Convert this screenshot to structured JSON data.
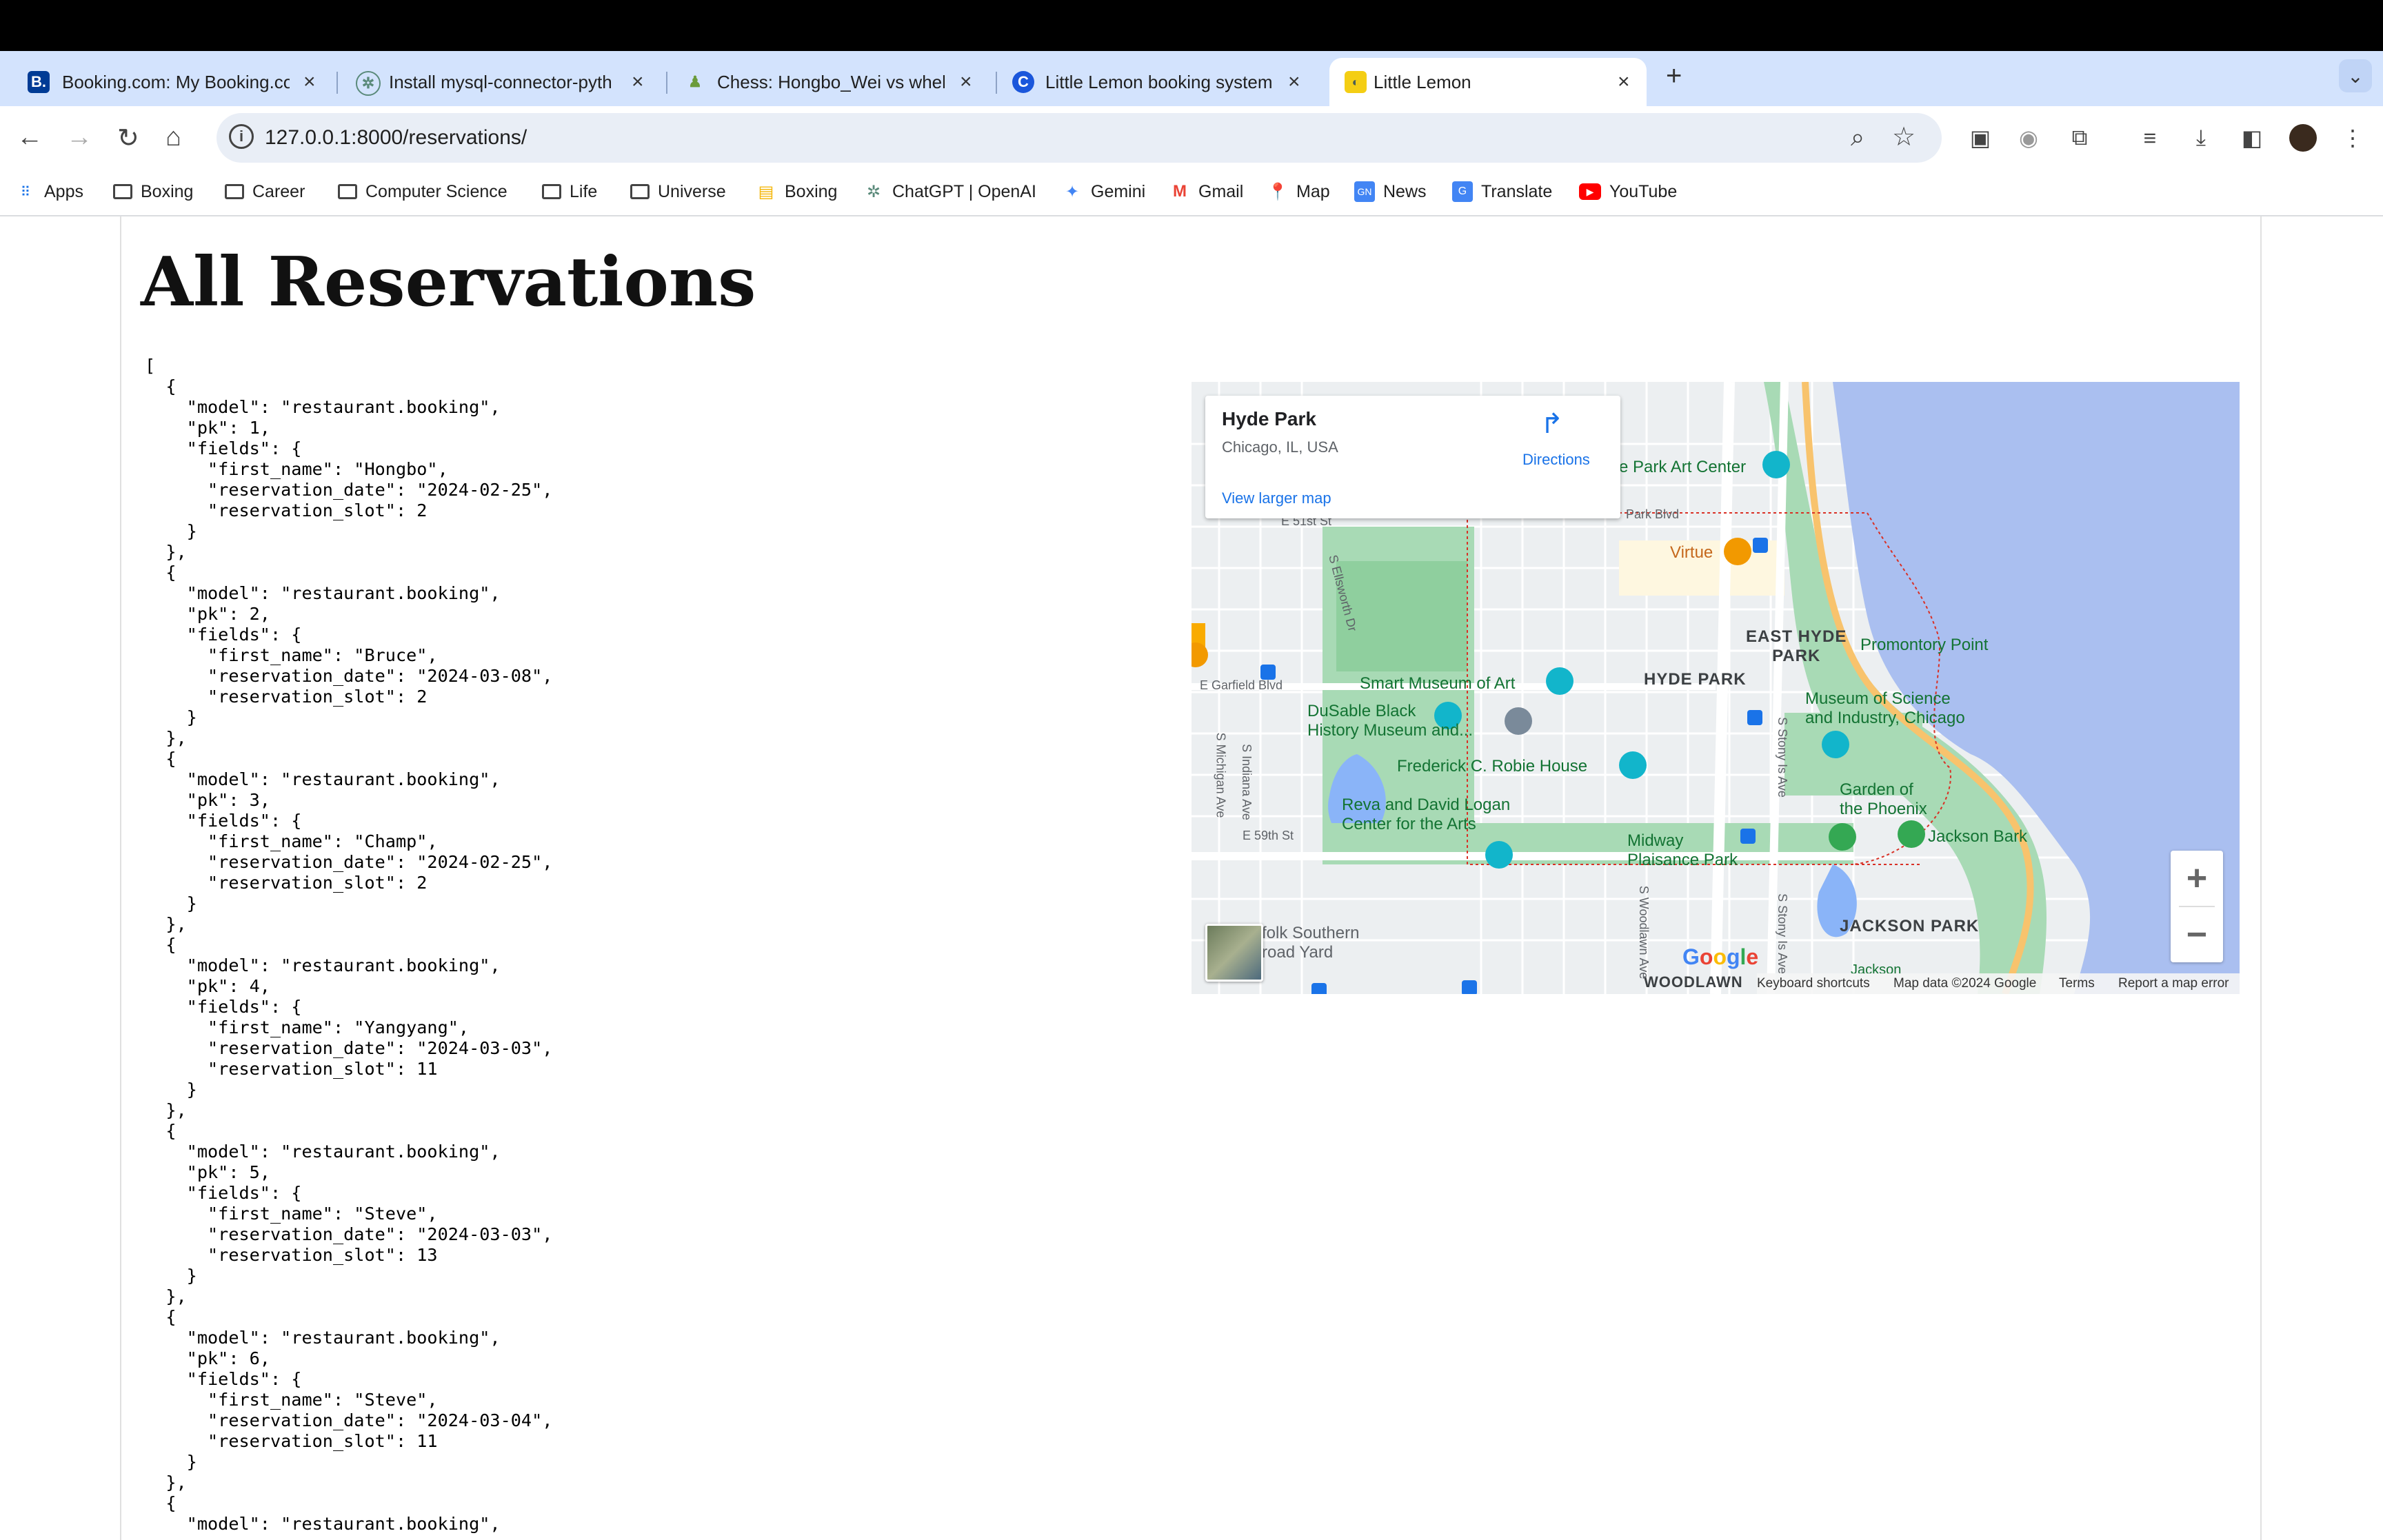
{
  "browser": {
    "tabs": [
      {
        "title": "Booking.com: My Booking.co",
        "favicon": "B.",
        "active": false
      },
      {
        "title": "Install mysql-connector-pyth",
        "favicon": "openai-icon",
        "active": false
      },
      {
        "title": "Chess: Hongbo_Wei vs wheh",
        "favicon": "chess-pawn-icon",
        "active": false
      },
      {
        "title": "Little Lemon booking system",
        "favicon": "C",
        "active": false
      },
      {
        "title": "Little Lemon",
        "favicon": "lemon-icon",
        "active": true
      }
    ],
    "url": "127.0.0.1:8000/reservations/",
    "bookmarks": [
      {
        "label": "Apps",
        "icon": "apps-grid-icon"
      },
      {
        "label": "Boxing",
        "icon": "folder-icon"
      },
      {
        "label": "Career",
        "icon": "folder-icon"
      },
      {
        "label": "Computer Science",
        "icon": "folder-icon"
      },
      {
        "label": "Life",
        "icon": "folder-icon"
      },
      {
        "label": "Universe",
        "icon": "folder-icon"
      },
      {
        "label": "Boxing",
        "icon": "boxing-icon"
      },
      {
        "label": "ChatGPT | OpenAI",
        "icon": "openai-icon"
      },
      {
        "label": "Gemini",
        "icon": "gemini-icon"
      },
      {
        "label": "Gmail",
        "icon": "gmail-icon"
      },
      {
        "label": "Map",
        "icon": "maps-icon"
      },
      {
        "label": "News",
        "icon": "news-icon"
      },
      {
        "label": "Translate",
        "icon": "translate-icon"
      },
      {
        "label": "YouTube",
        "icon": "youtube-icon"
      }
    ]
  },
  "page": {
    "heading": "All Reservations",
    "reservations": [
      {
        "model": "restaurant.booking",
        "pk": 1,
        "first_name": "Hongbo",
        "reservation_date": "2024-02-25",
        "reservation_slot": 2
      },
      {
        "model": "restaurant.booking",
        "pk": 2,
        "first_name": "Bruce",
        "reservation_date": "2024-03-08",
        "reservation_slot": 2
      },
      {
        "model": "restaurant.booking",
        "pk": 3,
        "first_name": "Champ",
        "reservation_date": "2024-02-25",
        "reservation_slot": 2
      },
      {
        "model": "restaurant.booking",
        "pk": 4,
        "first_name": "Yangyang",
        "reservation_date": "2024-03-03",
        "reservation_slot": 11
      },
      {
        "model": "restaurant.booking",
        "pk": 5,
        "first_name": "Steve",
        "reservation_date": "2024-03-03",
        "reservation_slot": 13
      },
      {
        "model": "restaurant.booking",
        "pk": 6,
        "first_name": "Steve",
        "reservation_date": "2024-03-04",
        "reservation_slot": 11
      }
    ],
    "trailing_json": "{\n  \"model\": \"restaurant.booking\","
  },
  "map": {
    "place_name": "Hyde Park",
    "place_address": "Chicago, IL, USA",
    "directions_label": "Directions",
    "larger_map_label": "View larger map",
    "zoom_in": "+",
    "zoom_out": "−",
    "google_logo": "Google",
    "footer": {
      "keyboard": "Keyboard shortcuts",
      "data": "Map data ©2024 Google",
      "terms": "Terms",
      "report": "Report a map error"
    },
    "labels": {
      "park_art_center": "e Park Art Center",
      "park_blvd": "Park Blvd",
      "virtue": "Virtue",
      "east_hyde_park": "EAST HYDE\nPARK",
      "promontory": "Promontory Point",
      "hyde_park": "HYDE PARK",
      "smart_museum": "Smart Museum of Art",
      "dusable": "DuSable Black\nHistory Museum and...",
      "museum_science": "Museum of Science\nand Industry, Chicago",
      "robie": "Frederick C. Robie House",
      "garden_phoenix": "Garden of\nthe Phoenix",
      "reva": "Reva and David Logan\nCenter for the Arts",
      "midway": "Midway\nPlaisance Park",
      "jackson_bark": "Jackson Bark",
      "jackson_park": "JACKSON PARK",
      "norfolk": "folk Southern\nroad Yard",
      "woodlawn": "WOODLAWN",
      "garfield": "E Garfield Blvd",
      "e59": "E 59th St",
      "e51": "E 51st St",
      "michigan": "S Michigan Ave",
      "indiana": "S Indiana Ave",
      "ellsworth": "S Ellsworth Dr",
      "woodlawn_ave": "S Woodlawn Ave",
      "stony": "S Stony Is Ave",
      "jackson_small": "Jackson"
    }
  }
}
